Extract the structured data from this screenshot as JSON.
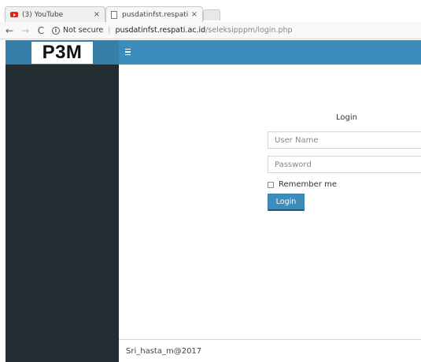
{
  "browser": {
    "tabs": [
      {
        "title": "(3) YouTube",
        "close": "×"
      },
      {
        "title": "pusdatinfst.respati.ac.id/s",
        "close": "×"
      }
    ],
    "nav": {
      "back": "←",
      "forward": "→",
      "reload": "C"
    },
    "address": {
      "info": "i",
      "security": "Not secure",
      "separator": "|",
      "host": "pusdatinfst.respati.ac.id",
      "path": "/seleksipppm/login.php"
    }
  },
  "app": {
    "logo": "P3M",
    "login": {
      "title": "Login",
      "username_placeholder": "User Name",
      "password_placeholder": "Password",
      "remember_label": "Remember me",
      "button_label": "Login"
    },
    "footer": "Sri_hasta_m@2017"
  },
  "colors": {
    "header": "#3c8dbc",
    "logo_bg": "#367fa9",
    "sidebar": "#222d32",
    "button": "#3c8dbc"
  },
  "icons": {
    "menu": "hamburger-icon",
    "youtube": "youtube-icon",
    "page": "page-icon",
    "info": "info-icon"
  }
}
